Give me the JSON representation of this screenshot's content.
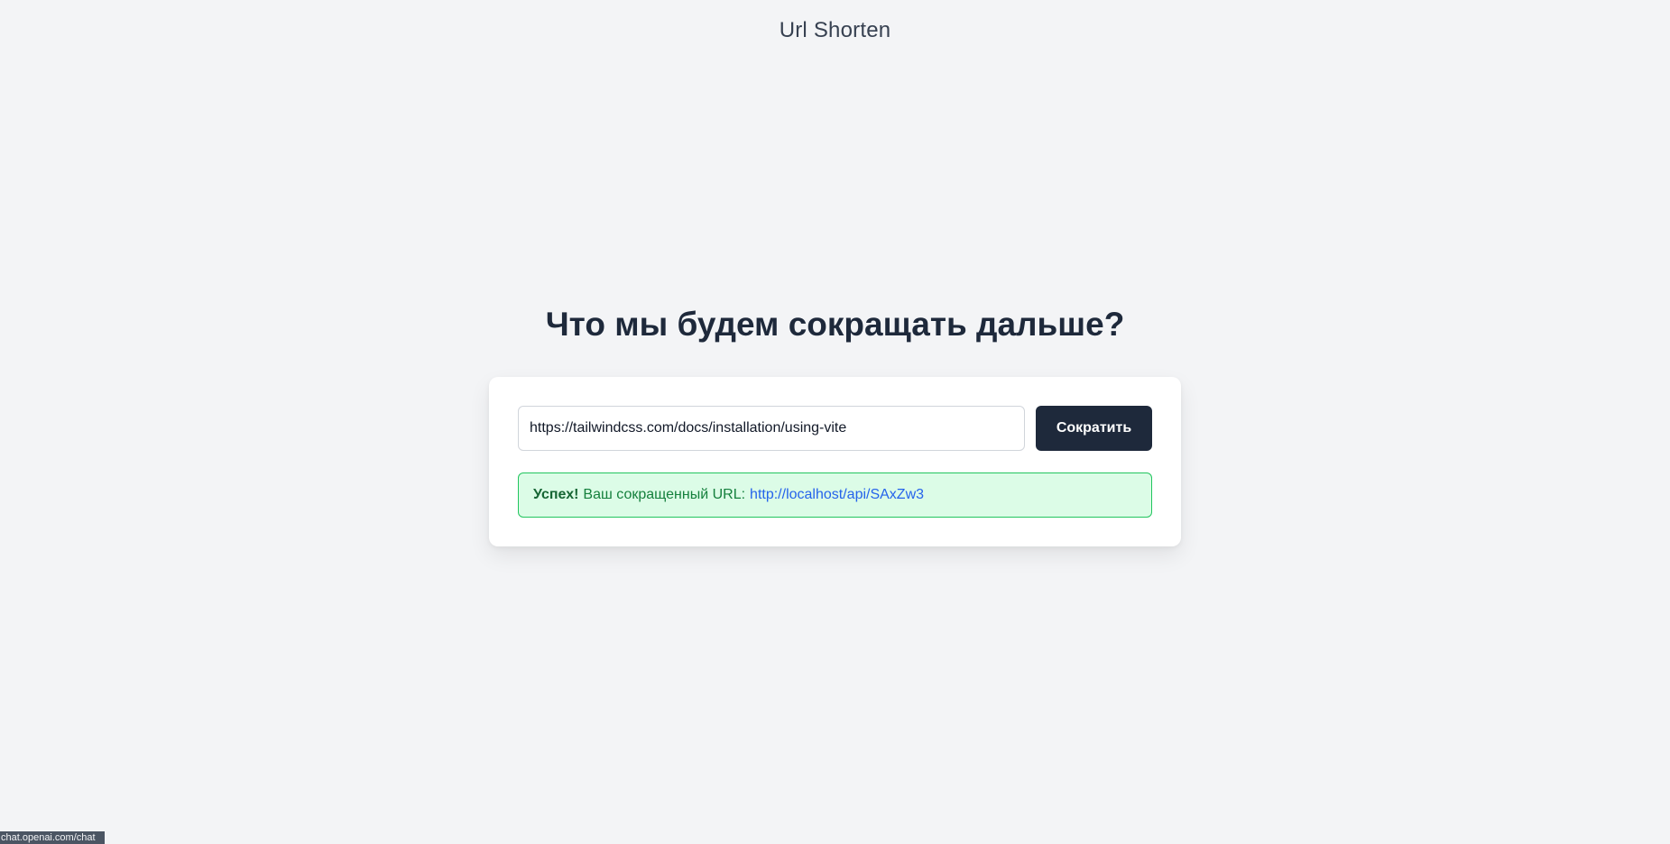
{
  "header": {
    "title": "Url Shorten"
  },
  "main": {
    "heading": "Что мы будем сокращать дальше?",
    "form": {
      "input_value": "https://tailwindcss.com/docs/installation/using-vite",
      "submit_label": "Сократить"
    },
    "alert": {
      "strong": "Успех!",
      "text": "Ваш сокращенный URL:",
      "link": "http://localhost/api/SAxZw3"
    }
  },
  "status_bar": {
    "url": "chat.openai.com/chat"
  },
  "colors": {
    "background": "#f3f4f6",
    "button_bg": "#1e293b",
    "alert_bg": "#dcfce7",
    "alert_border": "#22c55e",
    "alert_text": "#15803d",
    "link": "#2563eb"
  }
}
